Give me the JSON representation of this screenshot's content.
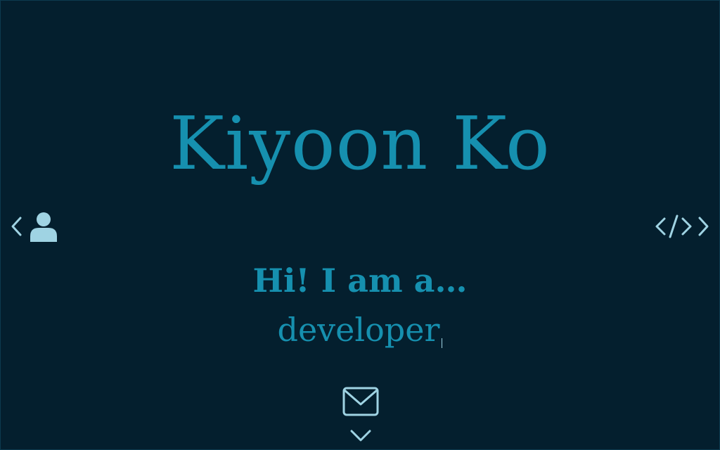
{
  "hero": {
    "name": "Kiyoon Ko",
    "greeting": "Hi! I am a…",
    "role": "developer"
  },
  "nav": {
    "left_icons": [
      "chevron-left-icon",
      "user-icon"
    ],
    "right_icons": [
      "code-icon",
      "chevron-right-icon"
    ]
  },
  "footer": {
    "icons": [
      "mail-icon",
      "chevron-down-icon"
    ]
  },
  "colors": {
    "background": "#041f2e",
    "accent": "#1690af",
    "icon": "#9fd3e3"
  }
}
